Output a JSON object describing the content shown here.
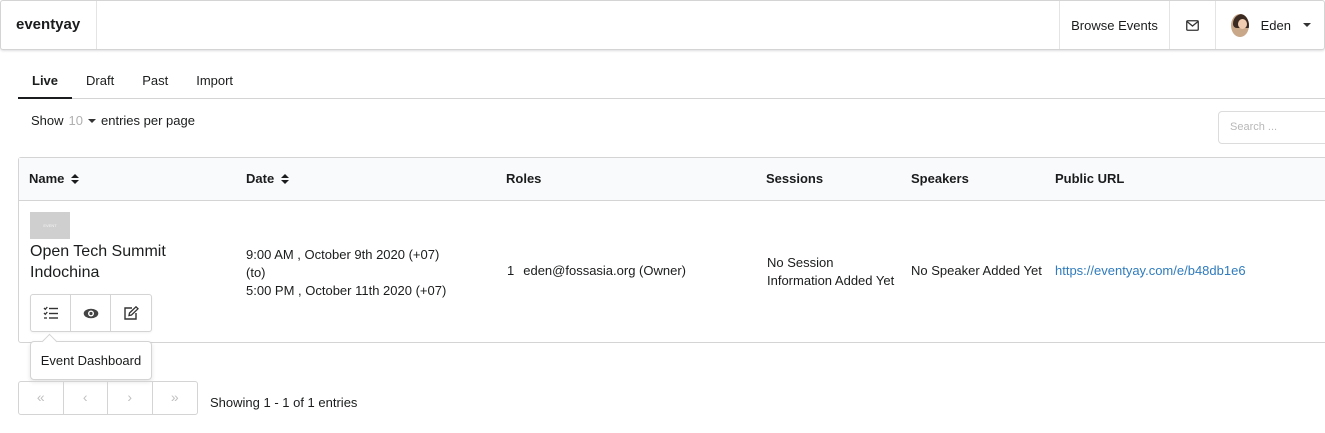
{
  "header": {
    "brand": "eventyay",
    "browse_events": "Browse Events",
    "user_name": "Eden",
    "mail_icon": "envelope-icon",
    "avatar_icon": "user-avatar"
  },
  "tabs": [
    {
      "label": "Live",
      "active": true
    },
    {
      "label": "Draft",
      "active": false
    },
    {
      "label": "Past",
      "active": false
    },
    {
      "label": "Import",
      "active": false
    }
  ],
  "controls": {
    "show_label": "Show",
    "per_page_value": "10",
    "per_page_suffix": "entries per page",
    "search_placeholder": "Search ..."
  },
  "table": {
    "columns": [
      "Name",
      "Date",
      "Roles",
      "Sessions",
      "Speakers",
      "Public URL"
    ],
    "rows": [
      {
        "thumbnail_text": "EVENT",
        "name": "Open Tech Summit Indochina",
        "date_start": "9:00 AM , October 9th 2020 (+07)",
        "date_to": "(to)",
        "date_end": "5:00 PM , October 11th 2020 (+07)",
        "role_count": "1",
        "role": "eden@fossasia.org (Owner)",
        "sessions": "No Session Information Added Yet",
        "speakers": "No Speaker Added Yet",
        "public_url": "https://eventyay.com/e/b48db1e6"
      }
    ],
    "row_actions": [
      "event-dashboard-icon",
      "eye-icon",
      "edit-icon"
    ]
  },
  "tooltip": "Event Dashboard",
  "pagination": {
    "first": "«",
    "prev": "‹",
    "next": "›",
    "last": "»",
    "summary": "Showing 1 - 1 of 1 entries"
  },
  "colors": {
    "link": "#2f7bbd",
    "border": "#d4d4d5",
    "header_bg": "#f9fafb"
  }
}
